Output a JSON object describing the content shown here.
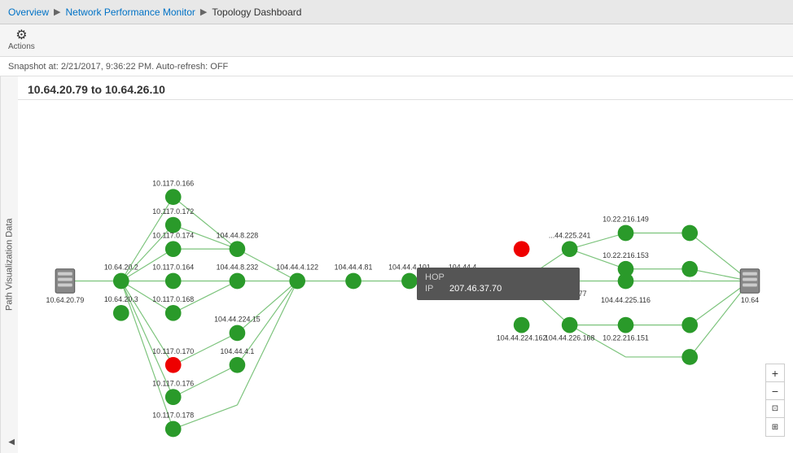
{
  "breadcrumb": {
    "items": [
      {
        "label": "Overview",
        "active": true
      },
      {
        "label": "Network Performance Monitor",
        "active": true
      },
      {
        "label": "Topology Dashboard",
        "active": false
      }
    ]
  },
  "toolbar": {
    "actions_label": "Actions",
    "actions_icon": "⚙"
  },
  "snapshot": {
    "text": "Snapshot at: 2/21/2017, 9:36:22 PM. Auto-refresh: OFF"
  },
  "sidebar": {
    "label": "Path Visualization Data",
    "arrow": "▶"
  },
  "panel": {
    "title": "10.64.20.79 to 10.64.26.10"
  },
  "tooltip": {
    "hop_label": "HOP",
    "ip_label": "IP",
    "ip_value": "207.46.37.70"
  },
  "zoom": {
    "plus": "+",
    "minus": "−",
    "reset": "⊡",
    "fit": "⊞"
  }
}
